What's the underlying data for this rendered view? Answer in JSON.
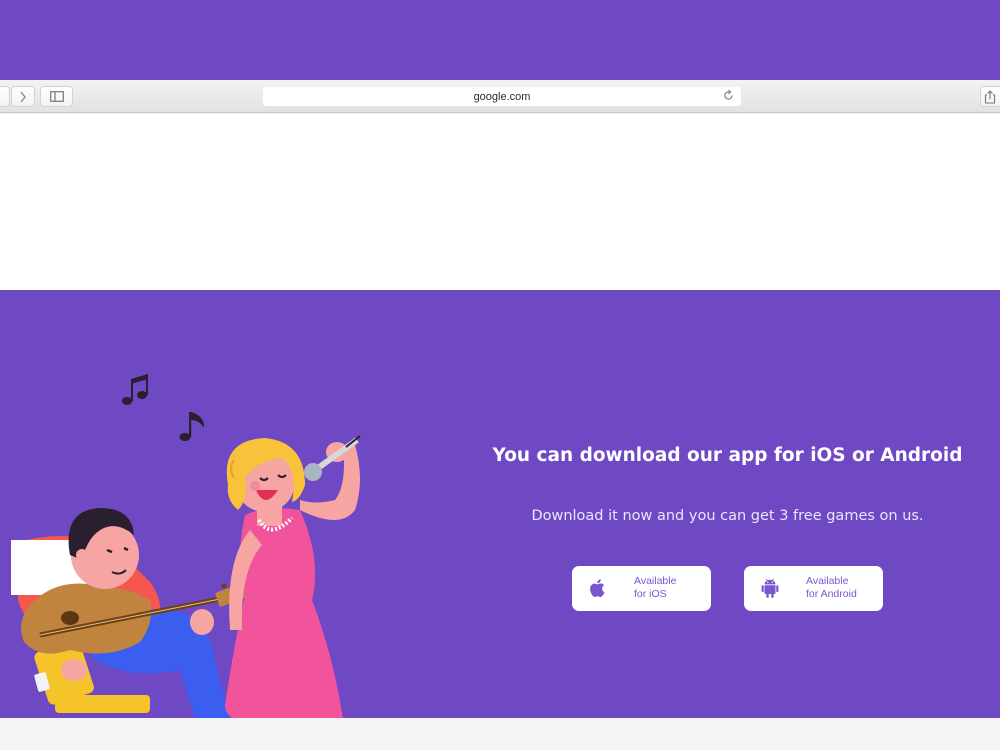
{
  "colors": {
    "brand_purple": "#6f48c4",
    "store_text": "#7a55d0",
    "toolbar_bg": "#ebebeb"
  },
  "browser": {
    "url": "google.com",
    "icons": {
      "back": "chevron-left-icon",
      "forward": "chevron-right-icon",
      "sidebar": "sidebar-icon",
      "reload": "reload-icon",
      "share": "share-icon"
    }
  },
  "hero": {
    "title": "You can download our app for iOS or Android",
    "subtitle": "Download it now and you can get 3 free games on us.",
    "buttons": [
      {
        "line1": "Available",
        "line2": "for iOS",
        "icon": "apple-icon"
      },
      {
        "line1": "Available",
        "line2": "for Android",
        "icon": "android-icon"
      }
    ]
  }
}
